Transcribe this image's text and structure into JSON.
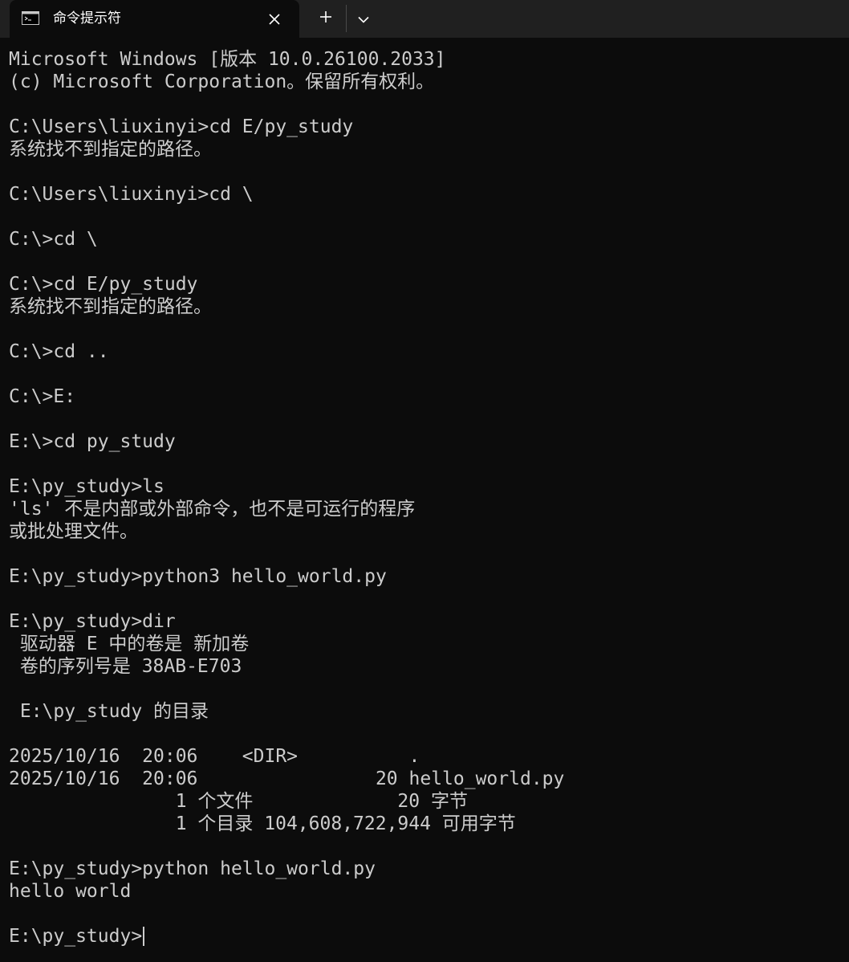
{
  "window": {
    "tab_title": "命令提示符",
    "icons": {
      "app": "cmd-icon",
      "close": "close-icon",
      "new_tab": "plus-icon",
      "dropdown": "chevron-down-icon"
    }
  },
  "terminal": {
    "lines": [
      "Microsoft Windows [版本 10.0.26100.2033]",
      "(c) Microsoft Corporation。保留所有权利。",
      "",
      "C:\\Users\\liuxinyi>cd E/py_study",
      "系统找不到指定的路径。",
      "",
      "C:\\Users\\liuxinyi>cd \\",
      "",
      "C:\\>cd \\",
      "",
      "C:\\>cd E/py_study",
      "系统找不到指定的路径。",
      "",
      "C:\\>cd ..",
      "",
      "C:\\>E:",
      "",
      "E:\\>cd py_study",
      "",
      "E:\\py_study>ls",
      "'ls' 不是内部或外部命令，也不是可运行的程序",
      "或批处理文件。",
      "",
      "E:\\py_study>python3 hello_world.py",
      "",
      "E:\\py_study>dir",
      " 驱动器 E 中的卷是 新加卷",
      " 卷的序列号是 38AB-E703",
      "",
      " E:\\py_study 的目录",
      "",
      "2025/10/16  20:06    <DIR>          .",
      "2025/10/16  20:06                20 hello_world.py",
      "               1 个文件             20 字节",
      "               1 个目录 104,608,722,944 可用字节",
      "",
      "E:\\py_study>python hello_world.py",
      "hello world",
      "",
      "E:\\py_study>"
    ],
    "colors": {
      "background": "#0c0c0c",
      "foreground": "#cccccc",
      "titlebar": "#202020"
    }
  }
}
